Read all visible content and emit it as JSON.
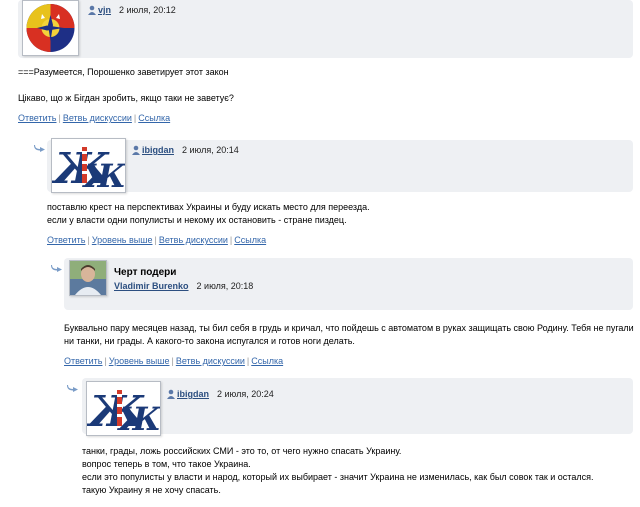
{
  "c1": {
    "user": "vjn",
    "date": "2 июля, 20:12",
    "lines": [
      "===Разумеется, Порошенко заветирует этот закон",
      "Цікаво, що ж Бігдан зробить, якщо таки не заветує?"
    ],
    "links": [
      "Ответить",
      "Ветвь дискуссии",
      "Ссылка"
    ]
  },
  "c2": {
    "user": "ibigdan",
    "date": "2 июля, 20:14",
    "lines": [
      "поставлю крест на перспективах Украины и буду искать место для переезда.",
      "если у власти одни популисты и некому их остановить - стране пиздец."
    ],
    "links": [
      "Ответить",
      "Уровень выше",
      "Ветвь дискуссии",
      "Ссылка"
    ]
  },
  "c3": {
    "title": "Черт подери",
    "user": "Vladimir Burenko",
    "date": "2 июля, 20:18",
    "lines": [
      "Буквально пару месяцев назад, ты бил себя в грудь и кричал, что пойдешь с автоматом в руках защищать свою Родину. Тебя не пугали",
      "ни танки, ни грады. А какого-то закона испугался и готов ноги делать."
    ],
    "links": [
      "Ответить",
      "Уровень выше",
      "Ветвь дискуссии",
      "Ссылка"
    ]
  },
  "c4": {
    "user": "ibigdan",
    "date": "2 июля, 20:24",
    "lines": [
      "танки, грады, ложь российских СМИ - это то, от чего нужно спасать Украину.",
      "вопрос теперь в том, что такое Украина.",
      "если это популисты у власти и народ, который их выбирает - значит Украина не изменилась, как был совок так и остался.",
      "такую Украину я не хочу спасать."
    ]
  },
  "colors": {
    "link": "#3366aa",
    "username": "#2c4f80",
    "header_bg": "#eef0f3"
  },
  "icons": [
    "user-icon",
    "reply-arrow-icon",
    "lj-logo-icon",
    "emblem-icon"
  ]
}
